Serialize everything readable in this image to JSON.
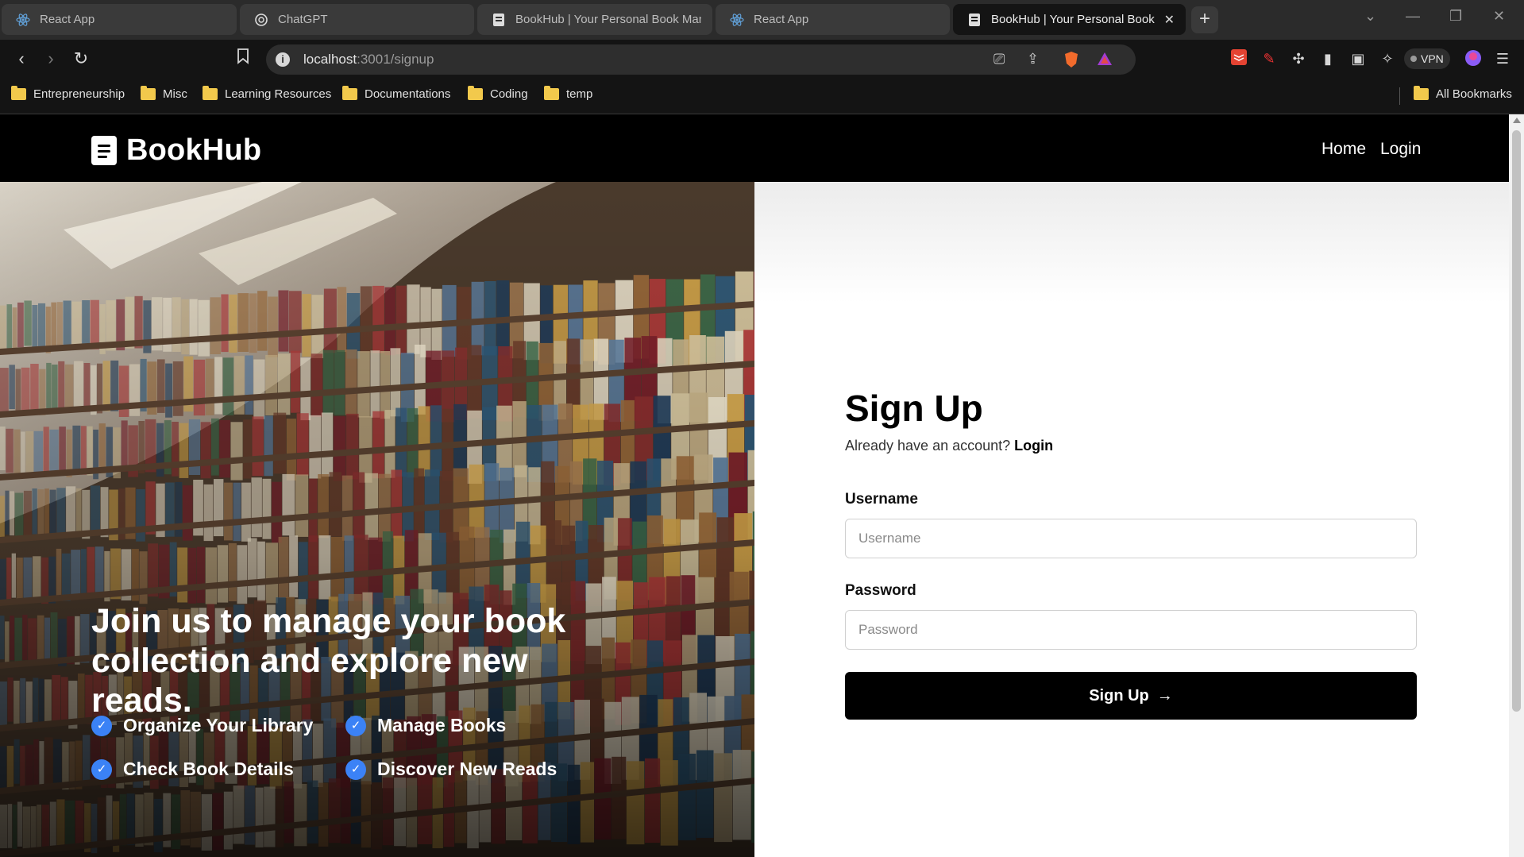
{
  "browser": {
    "tabs": [
      {
        "title": "React App",
        "icon": "react-icon",
        "active": false
      },
      {
        "title": "ChatGPT",
        "icon": "chatgpt-icon",
        "active": false
      },
      {
        "title": "BookHub | Your Personal Book Man",
        "icon": "bookhub-icon",
        "active": false
      },
      {
        "title": "React App",
        "icon": "react-icon",
        "active": false
      },
      {
        "title": "BookHub | Your Personal Book",
        "icon": "bookhub-icon",
        "active": true
      }
    ],
    "url_host": "localhost",
    "url_path": ":3001/signup",
    "vpn_label": "VPN",
    "bookmarks": [
      "Entrepreneurship",
      "Misc",
      "Learning Resources",
      "Documentations",
      "Coding",
      "temp"
    ],
    "all_bookmarks": "All Bookmarks"
  },
  "site": {
    "brand": "BookHub",
    "nav": {
      "home": "Home",
      "login": "Login"
    }
  },
  "hero": {
    "headline": "Join us to manage your book collection and explore new reads.",
    "features": [
      "Organize Your Library",
      "Manage Books",
      "Check Book Details",
      "Discover New Reads"
    ]
  },
  "form": {
    "title": "Sign Up",
    "subtitle_prefix": "Already have an account?",
    "subtitle_link": "Login",
    "username_label": "Username",
    "username_placeholder": "Username",
    "password_label": "Password",
    "password_placeholder": "Password",
    "submit_label": "Sign Up"
  },
  "colors": {
    "accent_check": "#3b82f6",
    "nav_bg": "#000000",
    "button_bg": "#000000"
  }
}
